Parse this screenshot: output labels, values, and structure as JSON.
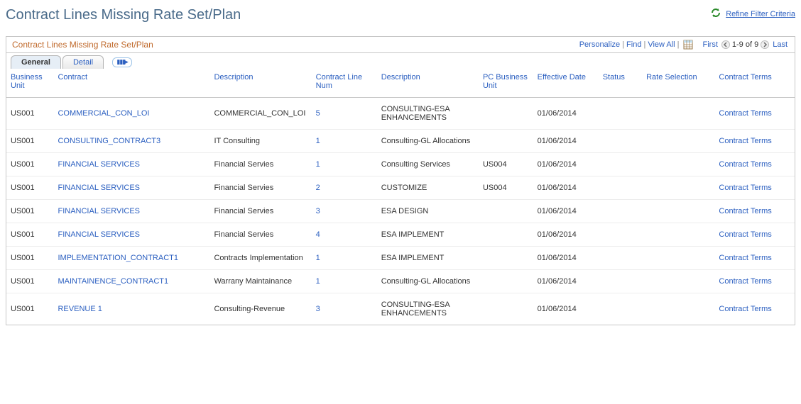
{
  "page_title": "Contract Lines Missing Rate Set/Plan",
  "refine_link": "Refine Filter Criteria",
  "grid": {
    "title": "Contract Lines Missing Rate Set/Plan",
    "personalize": "Personalize",
    "find": "Find",
    "view_all": "View All",
    "first": "First",
    "last": "Last",
    "range": "1-9 of 9",
    "tabs": {
      "general": "General",
      "detail": "Detail"
    },
    "columns": {
      "business_unit": "Business Unit",
      "contract": "Contract",
      "description1": "Description",
      "contract_line_num": "Contract Line Num",
      "description2": "Description",
      "pc_business_unit": "PC Business Unit",
      "effective_date": "Effective Date",
      "status": "Status",
      "rate_selection": "Rate Selection",
      "contract_terms": "Contract Terms"
    },
    "contract_terms_link": "Contract Terms",
    "rows": [
      {
        "bu": "US001",
        "contract": "COMMERCIAL_CON_LOI",
        "desc1": "COMMERCIAL_CON_LOI",
        "line": "5",
        "desc2": "CONSULTING-ESA ENHANCEMENTS",
        "pcbu": "",
        "eff": "01/06/2014",
        "status": "",
        "rate": ""
      },
      {
        "bu": "US001",
        "contract": "CONSULTING_CONTRACT3",
        "desc1": "IT Consulting",
        "line": "1",
        "desc2": "Consulting-GL Allocations",
        "pcbu": "",
        "eff": "01/06/2014",
        "status": "",
        "rate": ""
      },
      {
        "bu": "US001",
        "contract": "FINANCIAL SERVICES",
        "desc1": "Financial Servies",
        "line": "1",
        "desc2": "Consulting Services",
        "pcbu": "US004",
        "eff": "01/06/2014",
        "status": "",
        "rate": ""
      },
      {
        "bu": "US001",
        "contract": "FINANCIAL SERVICES",
        "desc1": "Financial Servies",
        "line": "2",
        "desc2": "CUSTOMIZE",
        "pcbu": "US004",
        "eff": "01/06/2014",
        "status": "",
        "rate": ""
      },
      {
        "bu": "US001",
        "contract": "FINANCIAL SERVICES",
        "desc1": "Financial Servies",
        "line": "3",
        "desc2": "ESA DESIGN",
        "pcbu": "",
        "eff": "01/06/2014",
        "status": "",
        "rate": ""
      },
      {
        "bu": "US001",
        "contract": "FINANCIAL SERVICES",
        "desc1": "Financial Servies",
        "line": "4",
        "desc2": "ESA IMPLEMENT",
        "pcbu": "",
        "eff": "01/06/2014",
        "status": "",
        "rate": ""
      },
      {
        "bu": "US001",
        "contract": "IMPLEMENTATION_CONTRACT1",
        "desc1": "Contracts Implementation",
        "line": "1",
        "desc2": "ESA IMPLEMENT",
        "pcbu": "",
        "eff": "01/06/2014",
        "status": "",
        "rate": ""
      },
      {
        "bu": "US001",
        "contract": "MAINTAINENCE_CONTRACT1",
        "desc1": "Warrany Maintainance",
        "line": "1",
        "desc2": "Consulting-GL Allocations",
        "pcbu": "",
        "eff": "01/06/2014",
        "status": "",
        "rate": ""
      },
      {
        "bu": "US001",
        "contract": "REVENUE 1",
        "desc1": "Consulting-Revenue",
        "line": "3",
        "desc2": "CONSULTING-ESA ENHANCEMENTS",
        "pcbu": "",
        "eff": "01/06/2014",
        "status": "",
        "rate": ""
      }
    ]
  }
}
